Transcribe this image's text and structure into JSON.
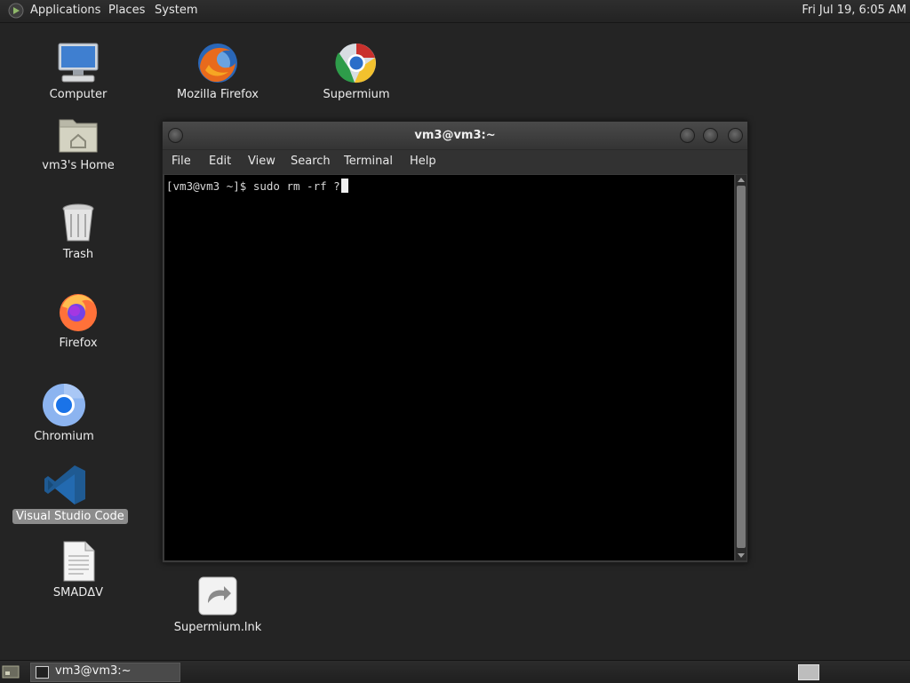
{
  "top_panel": {
    "menus": [
      "Applications",
      "Places",
      "System"
    ],
    "clock": "Fri Jul 19,  6:05 AM"
  },
  "desktop": {
    "icons": [
      {
        "label": "Computer",
        "icon": "computer-icon"
      },
      {
        "label": "Mozilla Firefox",
        "icon": "firefox-old-icon"
      },
      {
        "label": "Supermium",
        "icon": "supermium-icon"
      },
      {
        "label": "vm3's Home",
        "icon": "home-folder-icon"
      },
      {
        "label": "Trash",
        "icon": "trash-icon"
      },
      {
        "label": "Firefox",
        "icon": "firefox-icon"
      },
      {
        "label": "Chromium",
        "icon": "chromium-icon"
      },
      {
        "label": "Visual Studio Code",
        "icon": "vscode-icon",
        "selected": true
      },
      {
        "label": "SMADΔV",
        "icon": "document-icon"
      },
      {
        "label": "Supermium.lnk",
        "icon": "shortcut-icon"
      }
    ]
  },
  "terminal": {
    "title": "vm3@vm3:~",
    "menu": [
      "File",
      "Edit",
      "View",
      "Search",
      "Terminal",
      "Help"
    ],
    "prompt": "[vm3@vm3 ~]$ ",
    "command": "sudo rm -rf ?"
  },
  "taskbar": {
    "window_button": "vm3@vm3:~"
  }
}
